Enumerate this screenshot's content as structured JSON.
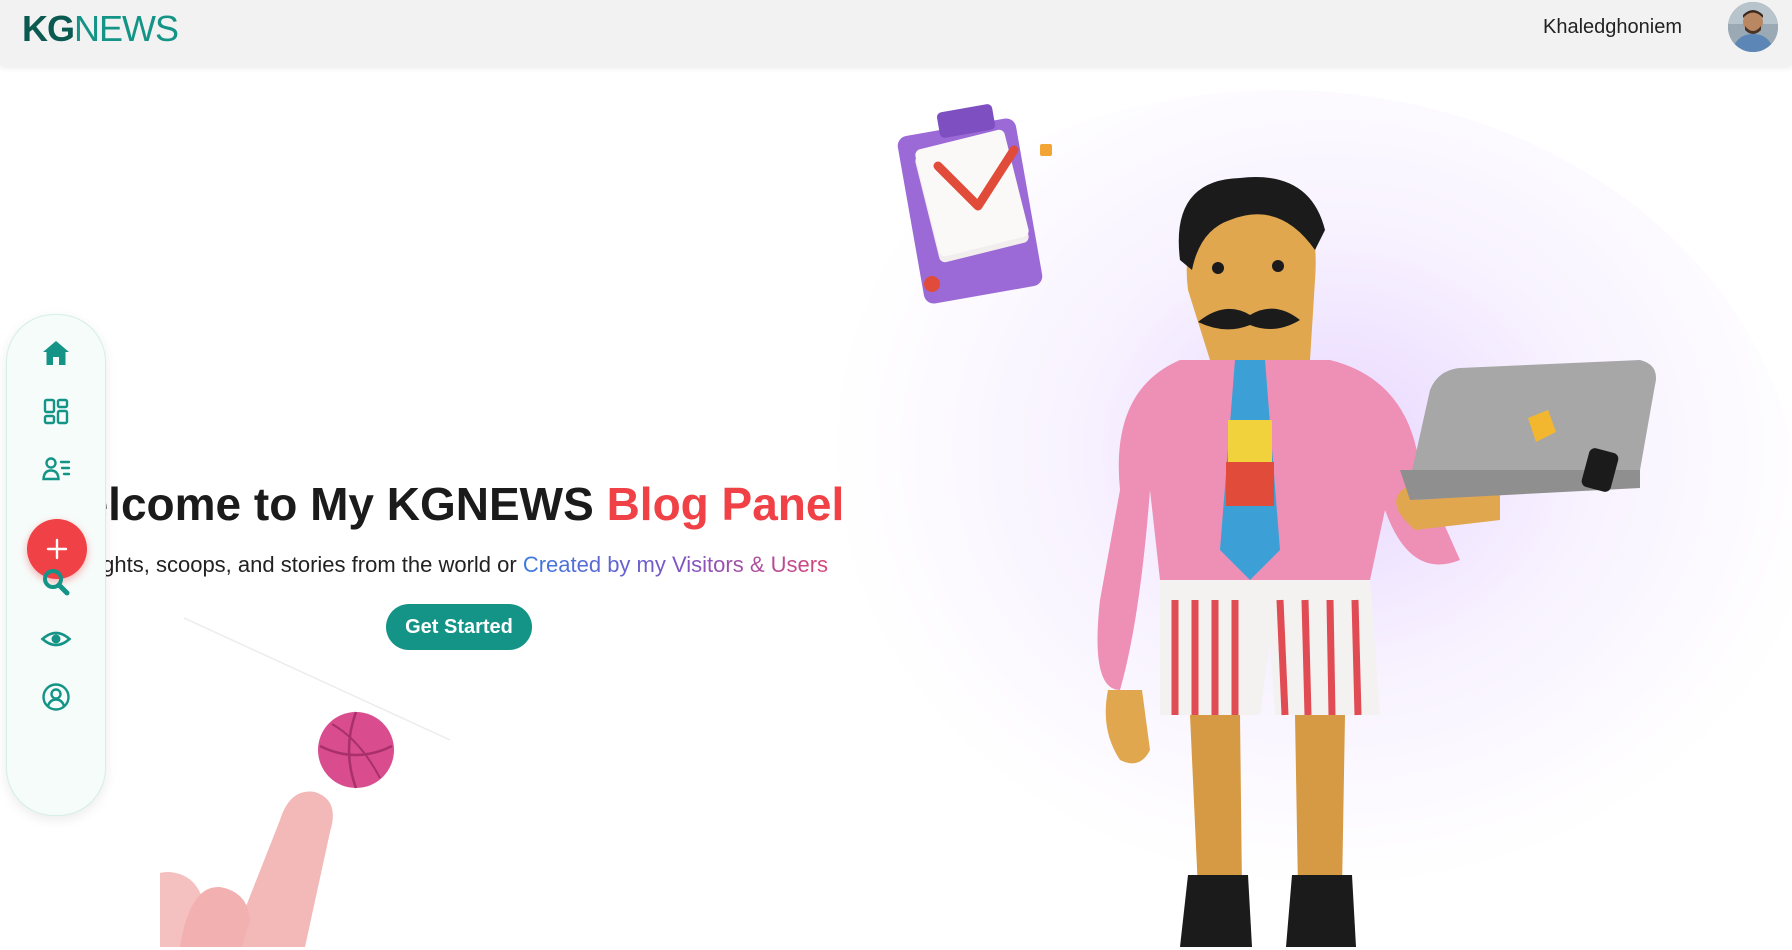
{
  "header": {
    "logo_primary": "KG",
    "logo_secondary": "NEWS",
    "username": "Khaledghoniem"
  },
  "sidebar": {
    "items": [
      {
        "name": "home",
        "icon": "home-icon"
      },
      {
        "name": "dashboard",
        "icon": "dashboard-grid-icon"
      },
      {
        "name": "users",
        "icon": "user-list-icon"
      },
      {
        "name": "add",
        "icon": "plus-icon"
      },
      {
        "name": "search",
        "icon": "search-icon"
      },
      {
        "name": "view",
        "icon": "eye-icon"
      },
      {
        "name": "profile",
        "icon": "user-circle-icon"
      }
    ]
  },
  "hero": {
    "title_main": "Welcome to My KGNEWS ",
    "title_accent": "Blog Panel",
    "subtitle_main": "Insights, scoops, and stories from the world or ",
    "subtitle_highlight": "Created by my Visitors & Users",
    "cta_label": "Get Started"
  },
  "colors": {
    "brand_teal": "#139486",
    "brand_dark": "#0b5a52",
    "accent_red": "#ef4146",
    "title_dark": "#1b1b1b"
  }
}
